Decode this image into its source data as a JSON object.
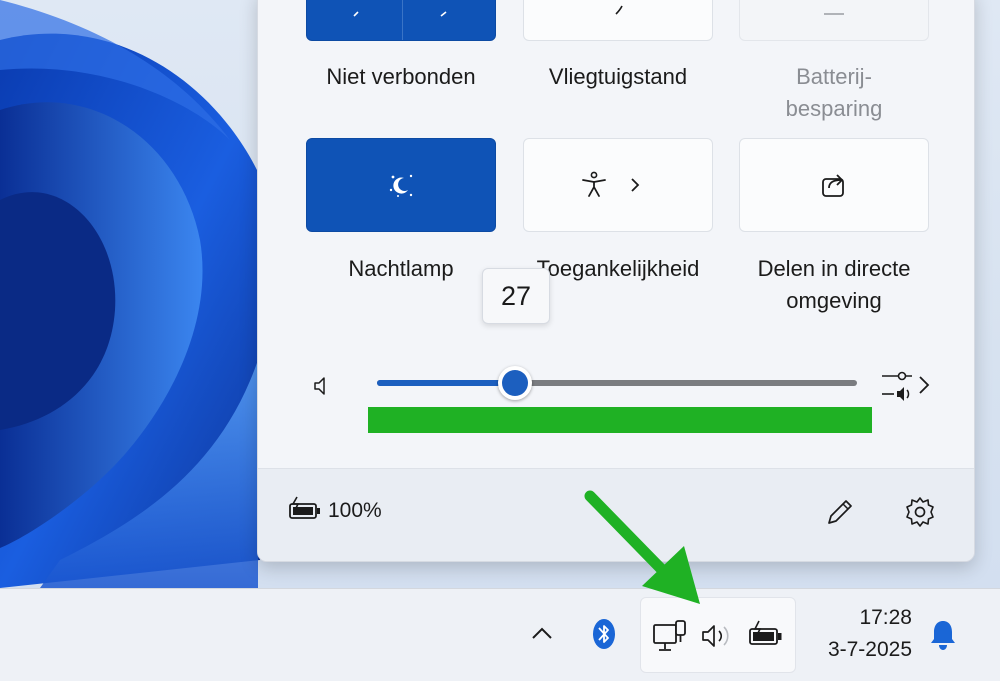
{
  "quick_settings": {
    "tiles_row1": [
      {
        "label": "Niet verbonden",
        "state": "on"
      },
      {
        "label": "Vliegtuigstand",
        "state": "off"
      },
      {
        "label": "Batterij-\nbesparing",
        "label_line1": "Batterij-",
        "label_line2": "besparing",
        "state": "disabled"
      }
    ],
    "tiles_row2": [
      {
        "label": "Nachtlamp",
        "icon": "night-light-icon",
        "state": "on"
      },
      {
        "label": "Toegankelijkheid",
        "icon": "accessibility-icon",
        "state": "off"
      },
      {
        "label_line1": "Delen in directe",
        "label_line2": "omgeving",
        "icon": "nearby-share-icon",
        "state": "off"
      }
    ],
    "volume": {
      "value": 27,
      "tooltip": "27",
      "icon": "speaker-icon",
      "mixer_icon": "audio-mixer-icon"
    },
    "footer": {
      "battery_text": "100%",
      "battery_icon": "battery-charging-icon",
      "edit_icon": "pencil-icon",
      "settings_icon": "gear-icon"
    }
  },
  "taskbar": {
    "tray_icons": [
      "chevron-up-icon",
      "bluetooth-icon",
      "network-icon",
      "volume-icon",
      "battery-charging-icon"
    ],
    "time": "17:28",
    "date": "3-7-2025",
    "notification_icon": "bell-icon"
  },
  "colors": {
    "accent": "#0f53b6",
    "highlight_bar": "#1fb124",
    "arrow": "#1fb124"
  }
}
